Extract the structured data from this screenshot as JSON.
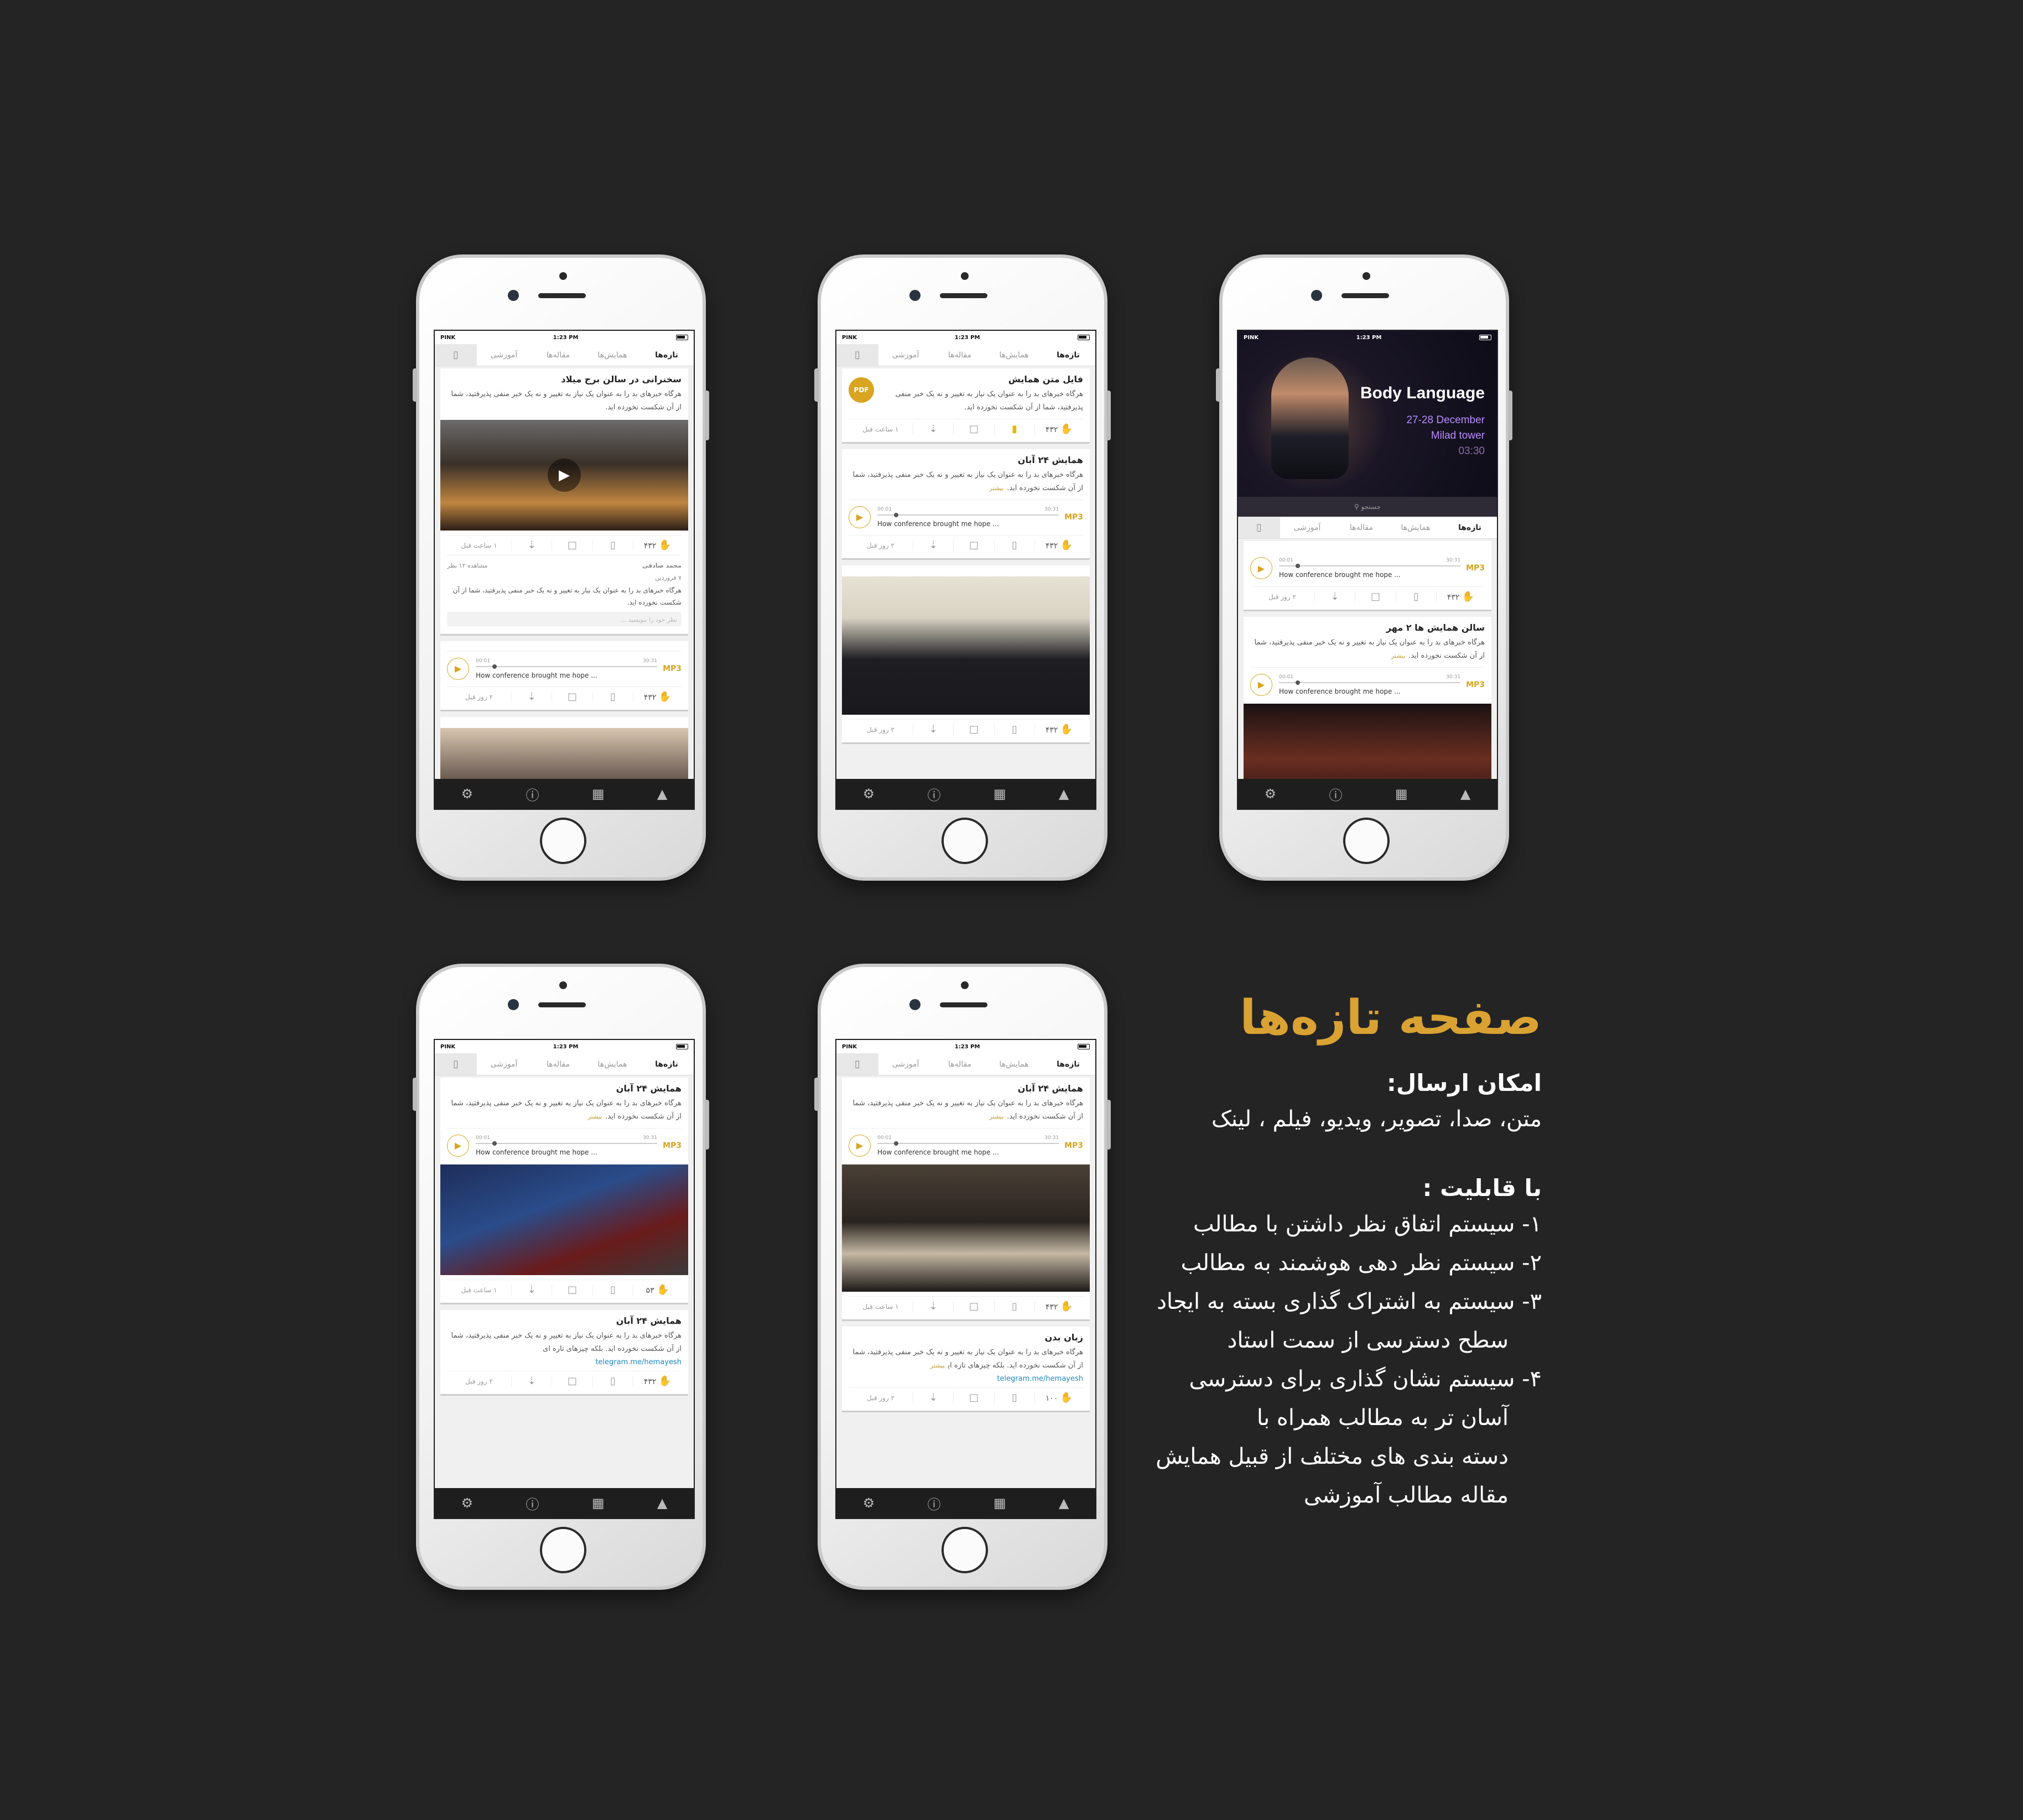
{
  "status": {
    "carrier": "PINK",
    "time": "1:23 PM"
  },
  "tabs": [
    "تازه‌ها",
    "همایش‌ها",
    "مقاله‌ها",
    "آموزشی"
  ],
  "hero": {
    "title": "Body Language",
    "date": "27-28 December",
    "place": "Milad tower",
    "time": "03:30",
    "search_placeholder": "جستجو"
  },
  "common": {
    "body": "هرگاه خبرهای بد را به عنوان یک نیاز به تغییر و نه یک خبر منفی پذیرفتید، شما از آن شکست نخورده اید.",
    "body_long": "هرگاه خبرهای بد را به عنوان یک نیاز به تغییر و نه یک خبر منفی پذیرفتید، شما از آن شکست نخورده اید. بلکه چیزهای تازه ای",
    "more": "بیشتر",
    "track": "How conference brought me hope ...",
    "mp3": "MP3",
    "t_start": "00:01",
    "t_end": "30:31",
    "hour_ago": "۱ ساعت قبل",
    "days_ago": "۲ روز قبل",
    "likes": "۴۳۲",
    "likes2": "۵۳",
    "likes3": "۱۰۰",
    "link": "telegram.me/hemayesh",
    "pdf": "PDF"
  },
  "titles": {
    "milad": "سخنرانی در سالن برج میلاد",
    "pdf": "فایل متن همایش",
    "aban": "همایش ۲۴ آبان",
    "mehr": "سالن همایش ها ۲ مهر",
    "zaban": "زبان بدن"
  },
  "comment": {
    "author": "محمد صادقی",
    "date": "۷ فروردین",
    "views": "مشاهده ۱۲ نظر",
    "reply": "نظر خود را بنویسید ..."
  },
  "panel": {
    "title": "صفحه تازه‌ها",
    "send_heading": "امکان ارسال:",
    "send_items": "متن، صدا، تصویر، ویدیو، فیلم ، لینک",
    "feature_heading": "با قابلیت :",
    "features": [
      "۱- سیستم اتفاق نظر داشتن با مطالب",
      "۲- سیستم نظر دهی هوشمند به مطالب",
      "۳- سیستم به اشتراک گذاری بسته به ایجاد",
      "سطح دسترسی از سمت استاد",
      "۴- سیستم نشان گذاری برای دسترسی",
      "آسان تر به مطالب همراه با",
      "دسته بندی های مختلف از قبیل همایش",
      "مقاله مطالب آموزشی"
    ]
  }
}
